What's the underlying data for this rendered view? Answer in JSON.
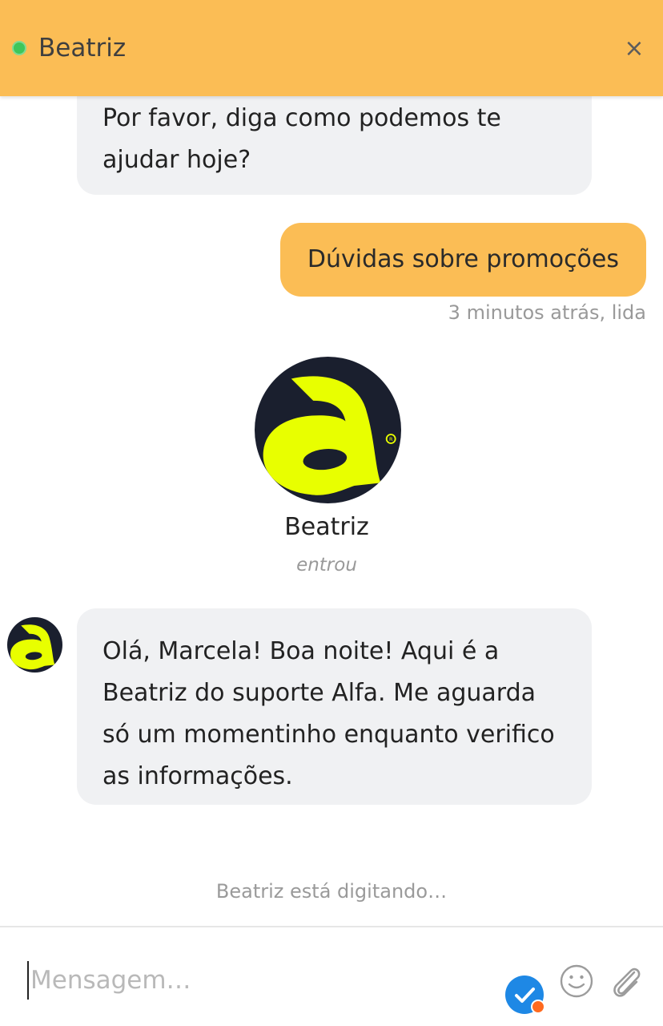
{
  "header": {
    "agent_name": "Beatriz",
    "status_color": "#3ec65a",
    "close_label": "×",
    "background": "#fbbd55"
  },
  "messages": {
    "agent_first": "Por favor, diga como podemos te ajudar hoje?",
    "user_reply": "Dúvidas sobre promoções",
    "user_meta": "3 minutos atrás, lida",
    "agent_joined_name": "Beatriz",
    "agent_joined_status": "entrou",
    "agent_second": "Olá, Marcela! Boa noite! Aqui é a Beatriz do suporte Alfa. Me aguarda só um momentinho enquanto verifico as informações."
  },
  "typing_indicator": "Beatriz está digitando…",
  "composer": {
    "placeholder": "Mensagem…",
    "value": "",
    "icons": [
      "check-badge-icon",
      "emoji-icon",
      "paperclip-icon"
    ]
  },
  "colors": {
    "accent": "#fbbd55",
    "agent_bubble": "#f0f1f3",
    "logo_dark": "#1a1f2e",
    "logo_yellow": "#e8ff00",
    "badge_blue": "#1e88e5"
  }
}
